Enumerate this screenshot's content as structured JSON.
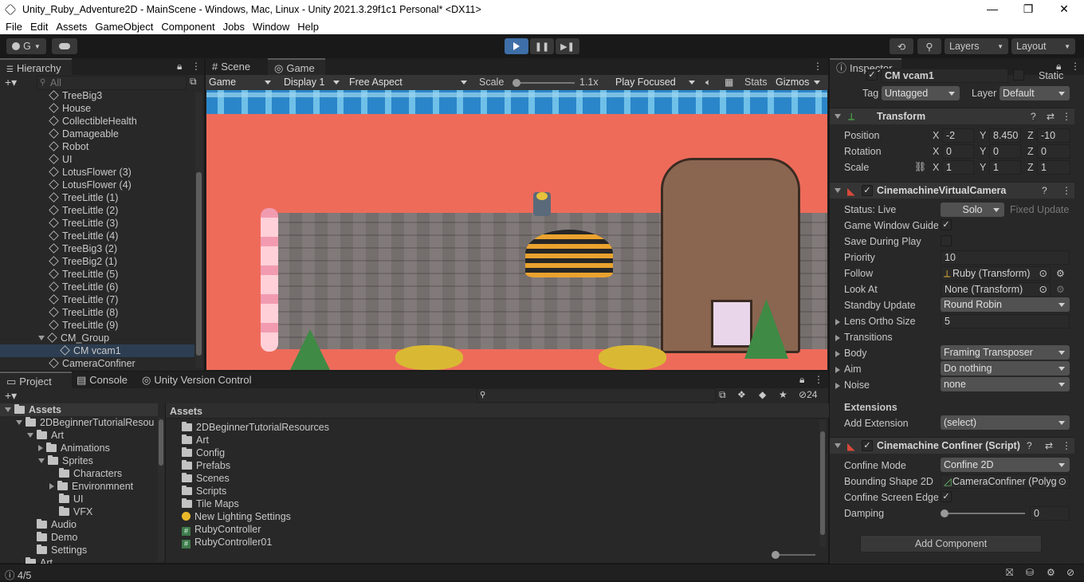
{
  "window": {
    "title": "Unity_Ruby_Adventure2D - MainScene - Windows, Mac, Linux - Unity 2021.3.29f1c1 Personal* <DX11>",
    "minimize": "—",
    "maximize": "❐",
    "close": "✕"
  },
  "menu": [
    "File",
    "Edit",
    "Assets",
    "GameObject",
    "Component",
    "Jobs",
    "Window",
    "Help"
  ],
  "toolbar": {
    "account": "G",
    "layers": "Layers",
    "layout": "Layout"
  },
  "hierarchy": {
    "tab": "Hierarchy",
    "search_placeholder": "All",
    "items": [
      "TreeBig3",
      "House",
      "CollectibleHealth",
      "Damageable",
      "Robot",
      "UI",
      "LotusFlower (3)",
      "LotusFlower (4)",
      "TreeLittle (1)",
      "TreeLittle (2)",
      "TreeLittle (3)",
      "TreeLittle (4)",
      "TreeBig3 (2)",
      "TreeBig2 (1)",
      "TreeLittle (5)",
      "TreeLittle (6)",
      "TreeLittle (7)",
      "TreeLittle (8)",
      "TreeLittle (9)",
      "CM_Group",
      "CM vcam1",
      "CameraConfiner"
    ]
  },
  "game": {
    "tab_scene": "Scene",
    "tab_game": "Game",
    "display_mode": "Game",
    "display": "Display 1",
    "aspect": "Free Aspect",
    "scale_label": "Scale",
    "scale_value": "1.1x",
    "play_focused": "Play Focused",
    "stats": "Stats",
    "gizmos": "Gizmos"
  },
  "inspector": {
    "tab": "Inspector",
    "object_name": "CM vcam1",
    "static": "Static",
    "tag_label": "Tag",
    "tag": "Untagged",
    "layer_label": "Layer",
    "layer": "Default",
    "transform": {
      "title": "Transform",
      "position_label": "Position",
      "rotation_label": "Rotation",
      "scale_label": "Scale",
      "pos": [
        "-2",
        "8.450",
        "-10"
      ],
      "rot": [
        "0",
        "0",
        "0"
      ],
      "scl": [
        "1",
        "1",
        "1"
      ]
    },
    "vcam": {
      "title": "CinemachineVirtualCamera",
      "status": "Status: Live",
      "solo": "Solo",
      "fixed_update": "Fixed Update",
      "guides": "Game Window Guides",
      "save_play": "Save During Play",
      "priority_label": "Priority",
      "priority": "10",
      "follow_label": "Follow",
      "follow": "Ruby (Transform)",
      "lookat_label": "Look At",
      "lookat": "None (Transform)",
      "standby_label": "Standby Update",
      "standby": "Round Robin",
      "lens_label": "Lens Ortho Size",
      "lens": "5",
      "transitions": "Transitions",
      "body_label": "Body",
      "body": "Framing Transposer",
      "aim_label": "Aim",
      "aim": "Do nothing",
      "noise_label": "Noise",
      "noise": "none",
      "extensions": "Extensions",
      "addext_label": "Add Extension",
      "addext": "(select)"
    },
    "confiner": {
      "title": "Cinemachine Confiner (Script)",
      "mode_label": "Confine Mode",
      "mode": "Confine 2D",
      "shape_label": "Bounding Shape 2D",
      "shape": "CameraConfiner (Polyg",
      "edges_label": "Confine Screen Edges",
      "damping_label": "Damping",
      "damping": "0"
    },
    "add_component": "Add Component"
  },
  "project": {
    "tab_project": "Project",
    "tab_console": "Console",
    "tab_vc": "Unity Version Control",
    "hidden_count": "24",
    "tree": [
      "Assets",
      "2DBeginnerTutorialResou",
      "Art",
      "Animations",
      "Sprites",
      "Characters",
      "Environmnent",
      "UI",
      "VFX",
      "Audio",
      "Demo",
      "Settings",
      "Art"
    ],
    "breadcrumb": "Assets",
    "files": [
      "2DBeginnerTutorialResources",
      "Art",
      "Config",
      "Prefabs",
      "Scenes",
      "Scripts",
      "Tile Maps",
      "New Lighting Settings",
      "RubyController",
      "RubyController01"
    ]
  },
  "status": {
    "left": "4/5"
  }
}
